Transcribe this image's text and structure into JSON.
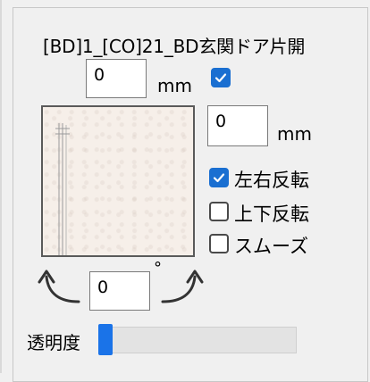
{
  "panel": {
    "title": "[BD]1_[CO]21_BD玄関ドア片開"
  },
  "offset_top": {
    "value": "0",
    "unit": "mm",
    "checkbox_checked": true
  },
  "offset_side": {
    "value": "0",
    "unit": "mm"
  },
  "options": {
    "flip_horizontal": {
      "label": "左右反転",
      "checked": true
    },
    "flip_vertical": {
      "label": "上下反転",
      "checked": false
    },
    "smooth": {
      "label": "スムーズ",
      "checked": false
    }
  },
  "rotation": {
    "value": "0",
    "unit": "°"
  },
  "opacity": {
    "label": "透明度",
    "value": 0
  },
  "icons": {
    "rotate_left": "rotate-ccw-arrow",
    "rotate_right": "rotate-cw-arrow"
  },
  "colors": {
    "accent": "#1a6fd1"
  }
}
